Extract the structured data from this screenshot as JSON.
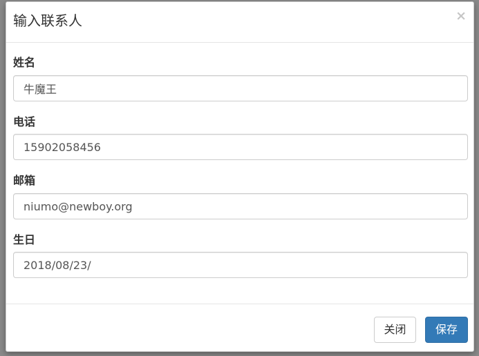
{
  "modal": {
    "title": "输入联系人",
    "close_symbol": "×"
  },
  "form": {
    "fields": [
      {
        "label": "姓名",
        "value": "牛魔王"
      },
      {
        "label": "电话",
        "value": "15902058456"
      },
      {
        "label": "邮箱",
        "value": "niumo@newboy.org"
      },
      {
        "label": "生日",
        "value": "2018/08/23/"
      }
    ]
  },
  "footer": {
    "close_label": "关闭",
    "save_label": "保存"
  },
  "colors": {
    "primary": "#337ab7",
    "backdrop": "#8a8a8a"
  }
}
